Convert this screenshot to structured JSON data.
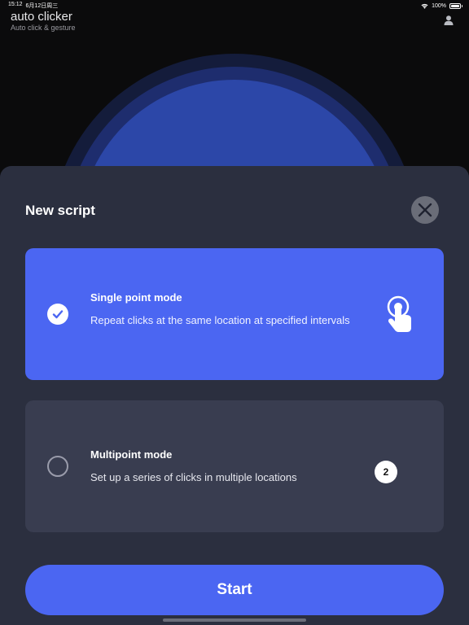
{
  "status_bar": {
    "time": "15:12",
    "date": "6月12日周三",
    "battery": "100%",
    "battery_level": 1.0
  },
  "header": {
    "title": "auto clicker",
    "subtitle": "Auto click & gesture"
  },
  "sheet": {
    "title": "New script",
    "modes": [
      {
        "title": "Single point mode",
        "description": "Repeat clicks at the same location at specified intervals",
        "selected": true
      },
      {
        "title": "Multipoint mode",
        "description": "Set up a series of clicks in multiple locations",
        "selected": false,
        "badge": "2"
      }
    ],
    "start_label": "Start"
  },
  "colors": {
    "accent": "#4b66f2",
    "sheet": "#2b2f3f",
    "card_unselected": "#393d50",
    "background": "#0b0b0c"
  }
}
